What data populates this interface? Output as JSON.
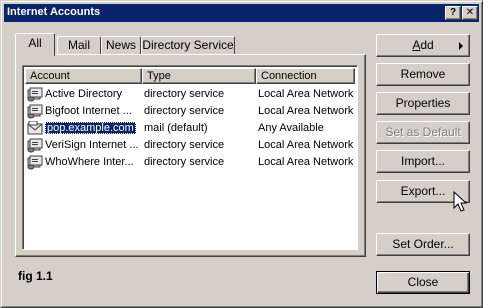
{
  "window": {
    "title": "Internet Accounts",
    "help_glyph": "?",
    "close_glyph": "✕"
  },
  "tabs": [
    {
      "label": "All",
      "active": true
    },
    {
      "label": "Mail",
      "active": false
    },
    {
      "label": "News",
      "active": false
    },
    {
      "label": "Directory Service",
      "active": false
    }
  ],
  "accounts": {
    "columns": [
      "Account",
      "Type",
      "Connection"
    ],
    "rows": [
      {
        "account": "Active Directory",
        "type": "directory service",
        "connection": "Local Area Network",
        "selected": false,
        "icon": "directory-service-icon"
      },
      {
        "account": "Bigfoot Internet ...",
        "type": "directory service",
        "connection": "Local Area Network",
        "selected": false,
        "icon": "directory-service-icon"
      },
      {
        "account": "pop.example.com",
        "type": "mail (default)",
        "connection": "Any Available",
        "selected": true,
        "icon": "mail-account-icon"
      },
      {
        "account": "VeriSign Internet ...",
        "type": "directory service",
        "connection": "Local Area Network",
        "selected": false,
        "icon": "directory-service-icon"
      },
      {
        "account": "WhoWhere Inter...",
        "type": "directory service",
        "connection": "Local Area Network",
        "selected": false,
        "icon": "directory-service-icon"
      }
    ]
  },
  "buttons": {
    "add_pre": "",
    "add_access": "A",
    "add_post": "dd",
    "remove": "Remove",
    "properties": "Properties",
    "set_default": "Set as Default",
    "import": "Import...",
    "export": "Export...",
    "set_order": "Set Order...",
    "close": "Close"
  },
  "caption": "fig 1.1",
  "colors": {
    "face": "#d4d0c8",
    "titlebar": "#0a246a",
    "selection": "#0a246a",
    "disabled_text": "#808080"
  }
}
